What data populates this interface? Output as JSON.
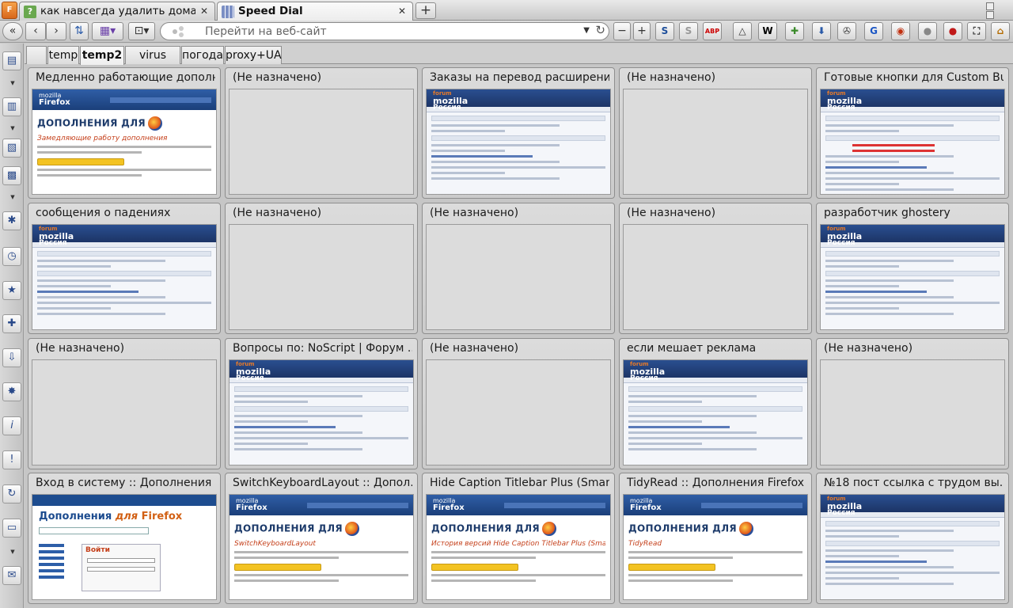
{
  "browser": {
    "menu_button_label": "F",
    "tabs": [
      {
        "label": "как навсегда удалить домаш...",
        "favicon_color": "#6aa84f",
        "active": false
      },
      {
        "label": "Speed Dial",
        "favicon_color": "#7b8fc4",
        "active": true
      }
    ],
    "new_tab_label": "+",
    "close_glyph": "✕"
  },
  "navbar": {
    "url_placeholder": "Перейти на веб-сайт",
    "url_value": "",
    "extensions": [
      {
        "name": "stylish",
        "glyph": "S",
        "color": "#1d4e9a"
      },
      {
        "name": "skype",
        "glyph": "S",
        "color": "#999"
      },
      {
        "name": "adblock",
        "glyph": "ABP",
        "color": "#c00"
      },
      {
        "name": "triangle",
        "glyph": "△",
        "color": "#333"
      },
      {
        "name": "wikipedia",
        "glyph": "W",
        "color": "#000"
      },
      {
        "name": "puzzle",
        "glyph": "✚",
        "color": "#3a8a2a"
      },
      {
        "name": "download",
        "glyph": "⬇",
        "color": "#2a5aa8"
      },
      {
        "name": "reel",
        "glyph": "✇",
        "color": "#444"
      },
      {
        "name": "google",
        "glyph": "G",
        "color": "#1a55c4"
      },
      {
        "name": "ghostery",
        "glyph": "◉",
        "color": "#c03010"
      },
      {
        "name": "wot",
        "glyph": "●",
        "color": "#888"
      },
      {
        "name": "record",
        "glyph": "●",
        "color": "#c01818"
      },
      {
        "name": "fullscreen",
        "glyph": "⛶",
        "color": "#333"
      },
      {
        "name": "home",
        "glyph": "⌂",
        "color": "#b36b00"
      }
    ]
  },
  "groups": {
    "tabs": [
      "temp",
      "temp2",
      "virus scan",
      "погода",
      "proxy+UA"
    ],
    "active_index": 1
  },
  "speed_dial": [
    {
      "title": "Медленно работающие дополн...",
      "thumb": "addons",
      "heading": "ДОПОЛНЕНИЯ ДЛЯ",
      "subtitle": "Замедляющие работу дополнения"
    },
    {
      "title": "(Не назначено)",
      "thumb": "empty"
    },
    {
      "title": "Заказы на перевод расширений...",
      "thumb": "forum"
    },
    {
      "title": "(Не назначено)",
      "thumb": "empty"
    },
    {
      "title": "Готовые кнопки для Custom Bu...",
      "thumb": "forum-red"
    },
    {
      "title": "сообщения о падениях",
      "thumb": "forum"
    },
    {
      "title": "(Не назначено)",
      "thumb": "empty"
    },
    {
      "title": "(Не назначено)",
      "thumb": "empty"
    },
    {
      "title": "(Не назначено)",
      "thumb": "empty"
    },
    {
      "title": "разработчик ghostery",
      "thumb": "forum"
    },
    {
      "title": "(Не назначено)",
      "thumb": "empty"
    },
    {
      "title": "Вопросы по: NoScript | Форум ...",
      "thumb": "forum"
    },
    {
      "title": "(Не назначено)",
      "thumb": "empty"
    },
    {
      "title": "если мешает реклама",
      "thumb": "forum"
    },
    {
      "title": "(Не назначено)",
      "thumb": "empty"
    },
    {
      "title": "Вход в систему :: Дополнения ...",
      "thumb": "login",
      "heading": "Дополнения",
      "heading2": "для",
      "heading3": "Firefox",
      "form_title": "Войти"
    },
    {
      "title": "SwitchKeyboardLayout :: Допол...",
      "thumb": "addons",
      "heading": "ДОПОЛНЕНИЯ ДЛЯ",
      "subtitle": "SwitchKeyboardLayout"
    },
    {
      "title": "Hide Caption Titlebar Plus (Smart)...",
      "thumb": "addons",
      "heading": "ДОПОЛНЕНИЯ ДЛЯ",
      "subtitle": "История версий Hide Caption Titlebar Plus (Smart)"
    },
    {
      "title": "TidyRead :: Дополнения Firefox",
      "thumb": "addons",
      "heading": "ДОПОЛНЕНИЯ ДЛЯ",
      "subtitle": "TidyRead"
    },
    {
      "title": "№18 пост ссылка с трудом вы...",
      "thumb": "forum"
    }
  ],
  "forum_logo": {
    "top": "forum",
    "main": "mozilla",
    "sub": "Россия"
  },
  "addons_logo": {
    "top": "mozilla",
    "main": "Firefox"
  }
}
